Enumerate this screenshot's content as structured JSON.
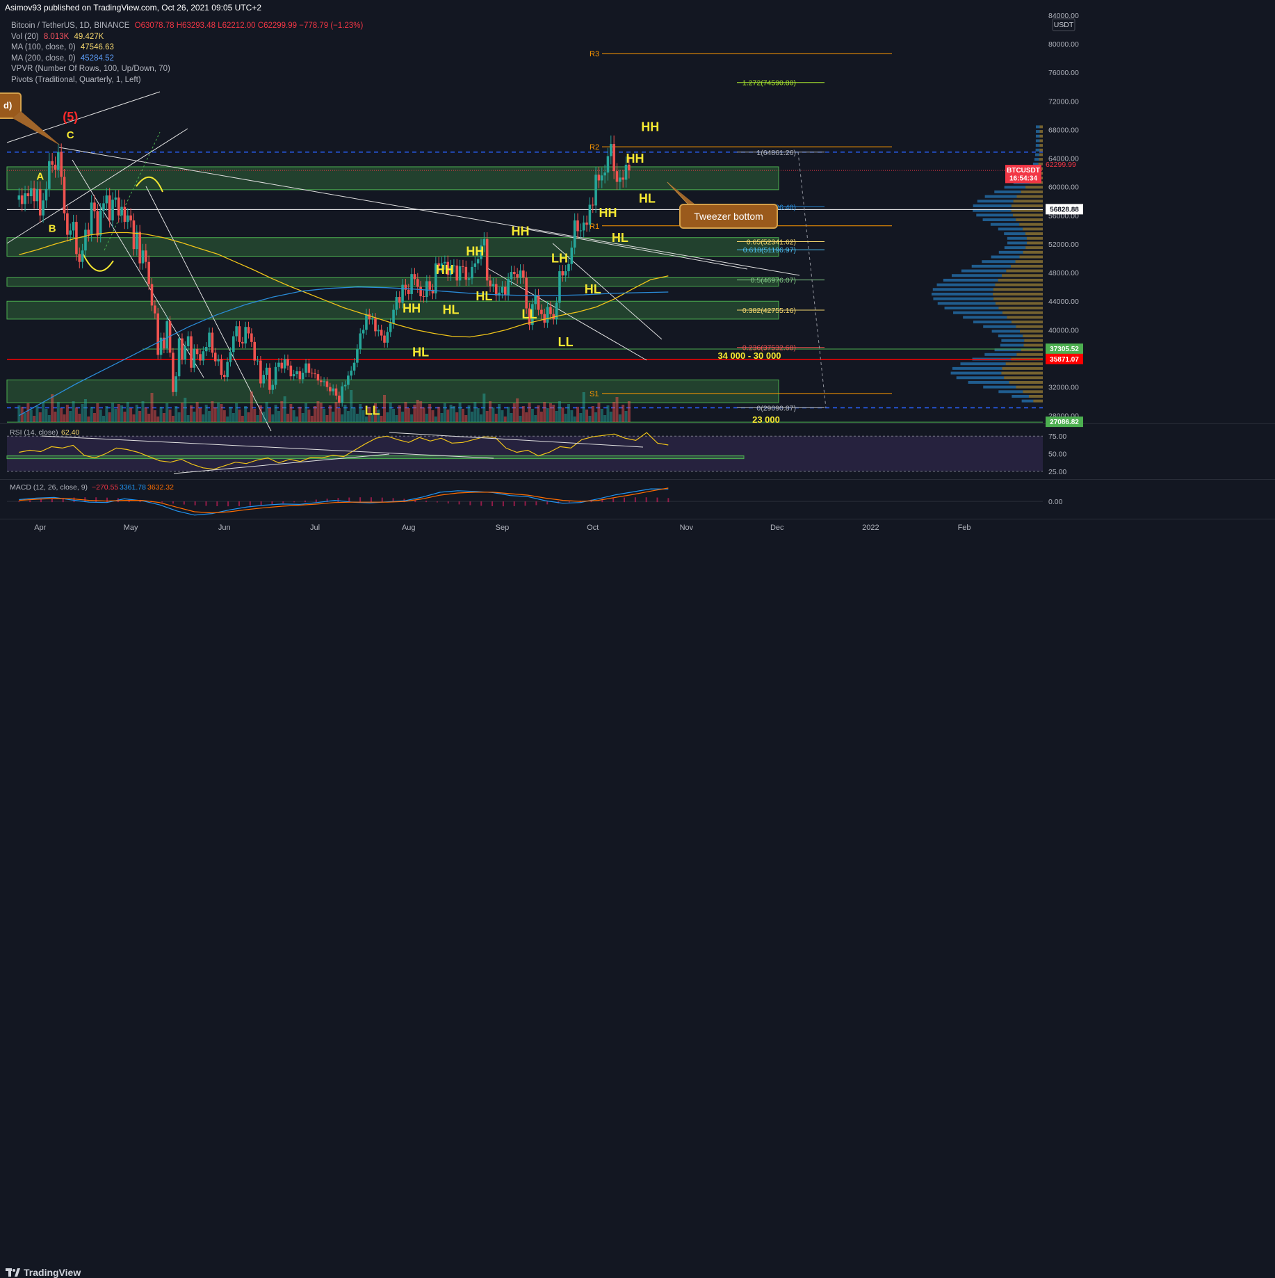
{
  "header": {
    "publish_line": "Asimov93 published on TradingView.com, Oct 26, 2021 09:05 UTC+2",
    "symbol": "Bitcoin / TetherUS, 1D, BINANCE",
    "ohlc": "O63078.78 H63293.48 L62212.00 C62299.99 −778.79 (−1.23%)",
    "vol_label": "Vol (20)",
    "vol_val1": "8.013K",
    "vol_val2": "49.427K",
    "ma100_label": "MA (100, close, 0)",
    "ma100_val": "47546.63",
    "ma200_label": "MA (200, close, 0)",
    "ma200_val": "45284.52",
    "vpvr_label": "VPVR (Number Of Rows, 100, Up/Down, 70)",
    "pivots_label": "Pivots (Traditional, Quarterly, 1, Left)",
    "currency": "USDT"
  },
  "footer": {
    "brand_icon": "tradingview-logo-icon",
    "brand": "TradingView"
  },
  "colors": {
    "background": "#131722",
    "bull": "#26a69a",
    "bear": "#ef5350",
    "zone": "#4caf50",
    "fib": "#ff9800",
    "ma100": "#f0c419",
    "ma200": "#2a8cd8",
    "label": "#f5e832"
  },
  "chart_data": [
    {
      "type": "line",
      "title": "Bitcoin / TetherUS, 1D, BINANCE",
      "ylim": [
        27000,
        84000
      ],
      "yticks": [
        "84000.00",
        "80000.00",
        "76000.00",
        "72000.00",
        "68000.00",
        "64000.00",
        "60000.00",
        "56000.00",
        "52000.00",
        "48000.00",
        "44000.00",
        "40000.00",
        "36000.00",
        "32000.00",
        "28000.00"
      ],
      "xticks": [
        "Apr",
        "May",
        "Jun",
        "Jul",
        "Aug",
        "Sep",
        "Oct",
        "Nov",
        "Dec",
        "2022",
        "Feb"
      ],
      "price_badges": [
        {
          "text": "BTCUSDT",
          "value": 62300,
          "color": "#f23645"
        },
        {
          "text": "16:54:34",
          "value": 61200,
          "color": "#f23645"
        },
        {
          "text": "56828.88",
          "value": 56828.88,
          "color": "#ffffff"
        },
        {
          "text": "37305.52",
          "value": 37305.52,
          "color": "#4caf50"
        },
        {
          "text": "35871.07",
          "value": 35871.07,
          "color": "#ff0000"
        },
        {
          "text": "27086.82",
          "value": 27086.82,
          "color": "#4caf50"
        }
      ],
      "last_price_text": "62299.99",
      "pivots": [
        {
          "label": "R3",
          "value": 78650
        },
        {
          "label": "R2",
          "value": 65600
        },
        {
          "label": "R1",
          "value": 54550
        },
        {
          "label": "S1",
          "value": 31100
        }
      ],
      "fib_levels": [
        {
          "label": "1.272(74590.80)",
          "value": 74590.8
        },
        {
          "label": "1(64861.26)",
          "value": 64861.26
        },
        {
          "label": "0.786(57206.40)",
          "value": 57206.4
        },
        {
          "label": "0.65(52341.62)",
          "value": 52341.62
        },
        {
          "label": "0.618(51196.97)",
          "value": 51196.97
        },
        {
          "label": "0.5(46976.07)",
          "value": 46976.07
        },
        {
          "label": "0.382(42755.16)",
          "value": 42755.16
        },
        {
          "label": "0.236(37532.68)",
          "value": 37532.68
        },
        {
          "label": "0(29090.87)",
          "value": 29090.87
        }
      ],
      "zone_labels": [
        "34 000 - 30 000",
        "23 000"
      ],
      "annotations": [
        {
          "text": "HH",
          "x": "2021-10-20",
          "y": 67800
        },
        {
          "text": "HH",
          "x": "2021-10-15",
          "y": 63400
        },
        {
          "text": "HL",
          "x": "2021-10-19",
          "y": 57800
        },
        {
          "text": "HH",
          "x": "2021-10-06",
          "y": 55800
        },
        {
          "text": "HL",
          "x": "2021-10-10",
          "y": 52300
        },
        {
          "text": "HH",
          "x": "2021-09-07",
          "y": 53200
        },
        {
          "text": "LH",
          "x": "2021-09-20",
          "y": 49400
        },
        {
          "text": "HL",
          "x": "2021-10-01",
          "y": 45100
        },
        {
          "text": "HH",
          "x": "2021-08-23",
          "y": 50400
        },
        {
          "text": "HH",
          "x": "2021-08-13",
          "y": 47800
        },
        {
          "text": "HL",
          "x": "2021-08-26",
          "y": 44100
        },
        {
          "text": "HL",
          "x": "2021-08-15",
          "y": 42200
        },
        {
          "text": "LL",
          "x": "2021-09-10",
          "y": 41600
        },
        {
          "text": "LL",
          "x": "2021-09-22",
          "y": 37700
        },
        {
          "text": "HH",
          "x": "2021-08-02",
          "y": 42400
        },
        {
          "text": "HL",
          "x": "2021-08-05",
          "y": 36300
        },
        {
          "text": "LL",
          "x": "2021-07-20",
          "y": 28100
        },
        {
          "text": "A",
          "x": "2021-04-01",
          "y": 61000
        },
        {
          "text": "B",
          "x": "2021-04-05",
          "y": 53700
        },
        {
          "text": "C",
          "x": "2021-04-11",
          "y": 66800
        },
        {
          "text": "(5)",
          "x": "2021-04-11",
          "y": 69200
        }
      ],
      "callouts": [
        {
          "text": "Tweezer bottom",
          "x": "2021-10-21",
          "y": 60000
        },
        {
          "text": "d)",
          "x": "2021-03-25",
          "y": 71000
        }
      ],
      "series": [
        {
          "name": "Bitcoin / TetherUS",
          "type": "candlestick",
          "closes": [
            58800,
            57600,
            59100,
            58700,
            59800,
            58000,
            59700,
            56000,
            58100,
            59700,
            63600,
            63100,
            62400,
            64900,
            61400,
            56300,
            53300,
            53900,
            55100,
            50600,
            49500,
            51100,
            54000,
            53300,
            57800,
            56600,
            53200,
            56700,
            57700,
            58800,
            55300,
            58200,
            58500,
            56000,
            57200,
            55100,
            56000,
            55300,
            51300,
            53700,
            49300,
            51100,
            49500,
            46400,
            43400,
            42300,
            36500,
            38900,
            37400,
            41200,
            36800,
            31300,
            33500,
            38800,
            35800,
            37700,
            39100,
            34700,
            37300,
            36600,
            35700,
            37000,
            37600,
            39600,
            36800,
            35600,
            35900,
            33700,
            33400,
            35500,
            36900,
            39100,
            40500,
            38300,
            38100,
            40400,
            39500,
            38300,
            35700,
            35700,
            32500,
            33700,
            34700,
            31600,
            32300,
            34800,
            35400,
            34600,
            35900,
            35000,
            33500,
            33800,
            34200,
            33100,
            34000,
            35300,
            34000,
            33900,
            33800,
            32900,
            32700,
            32800,
            32000,
            31400,
            31800,
            30800,
            29800,
            32100,
            32300,
            33600,
            34300,
            35400,
            37300,
            39500,
            40000,
            42200,
            41500,
            41600,
            39800,
            40000,
            39200,
            38200,
            39700,
            40900,
            42800,
            44600,
            43800,
            46300,
            45600,
            45000,
            47800,
            47100,
            46000,
            44700,
            44600,
            46800,
            45600,
            45100,
            49300,
            48900,
            49300,
            49500,
            47700,
            48900,
            49000,
            46900,
            48900,
            48800,
            47000,
            47200,
            48800,
            49300,
            49900,
            51800,
            52700,
            46900,
            46100,
            46400,
            44800,
            45200,
            46000,
            44900,
            47100,
            48100,
            47800,
            47300,
            48300,
            47300,
            43000,
            40700,
            43600,
            44900,
            42800,
            42200,
            41000,
            43200,
            42200,
            41500,
            43800,
            48200,
            47600,
            48200,
            49200,
            51500,
            55300,
            53800,
            53900,
            55000,
            54700,
            57500,
            57400,
            61700,
            60900,
            61600,
            62000,
            64300,
            66000,
            62200,
            60700,
            61300,
            61000,
            63100,
            62300
          ]
        },
        {
          "name": "MA (100, close, 0)",
          "values": [
            50500,
            51200,
            52000,
            52700,
            53300,
            53600,
            53600,
            53400,
            52900,
            52200,
            51400,
            50600,
            49500,
            48400,
            47200,
            46100,
            45100,
            44100,
            43100,
            42300,
            41500,
            40700,
            40000,
            39500,
            39100,
            39000,
            39400,
            40000,
            40800,
            41400,
            42000,
            42500,
            43200,
            44300,
            45700,
            47000,
            47546.63
          ]
        },
        {
          "name": "MA (200, close, 0)",
          "values": [
            28000,
            30200,
            32400,
            34400,
            36400,
            38400,
            40400,
            42100,
            43500,
            44600,
            45400,
            45800,
            46000,
            45900,
            45700,
            45400,
            45100,
            44900,
            44800,
            44800,
            44900,
            45100,
            45200,
            45284.52
          ]
        }
      ]
    },
    {
      "type": "line",
      "title": "RSI (14, close)",
      "value_text": "62.40",
      "ylim": [
        15,
        90
      ],
      "yticks": [
        "75.00",
        "50.00",
        "25.00"
      ],
      "series": [
        {
          "name": "RSI",
          "values": [
            52,
            55,
            53,
            60,
            58,
            62,
            48,
            44,
            50,
            58,
            56,
            52,
            46,
            40,
            38,
            42,
            35,
            30,
            28,
            33,
            38,
            36,
            41,
            44,
            37,
            42,
            39,
            45,
            44,
            48,
            46,
            55,
            64,
            72,
            75,
            70,
            66,
            73,
            68,
            72,
            65,
            66,
            70,
            74,
            73,
            58,
            52,
            55,
            47,
            52,
            60,
            58,
            70,
            74,
            76,
            78,
            72,
            69,
            80,
            65,
            62.4
          ]
        }
      ]
    },
    {
      "type": "line",
      "title": "MACD (12, 26, close, 9)",
      "ylim": [
        -4500,
        5500
      ],
      "yticks": [
        "0.00"
      ],
      "values_text": [
        "−270.55",
        "3361.78",
        "3632.32"
      ],
      "series": [
        {
          "name": "MACD",
          "values": [
            500,
            900,
            1100,
            400,
            -200,
            -300,
            700,
            200,
            -900,
            -2600,
            -3700,
            -3300,
            -2300,
            -1500,
            -1000,
            -700,
            -800,
            -300,
            300,
            -200,
            -400,
            -100,
            200,
            1200,
            2500,
            2900,
            2700,
            2400,
            1600,
            1300,
            200,
            -500,
            -300,
            700,
            1800,
            2600,
            3400,
            3361.78
          ]
        },
        {
          "name": "Signal",
          "values": [
            300,
            600,
            800,
            700,
            300,
            100,
            300,
            300,
            -300,
            -1600,
            -2800,
            -3100,
            -2800,
            -2200,
            -1700,
            -1300,
            -1000,
            -700,
            -300,
            -200,
            -200,
            -200,
            0,
            700,
            1700,
            2300,
            2500,
            2500,
            2100,
            1700,
            900,
            300,
            0,
            300,
            1100,
            1900,
            2800,
            3632.32
          ]
        }
      ]
    }
  ]
}
